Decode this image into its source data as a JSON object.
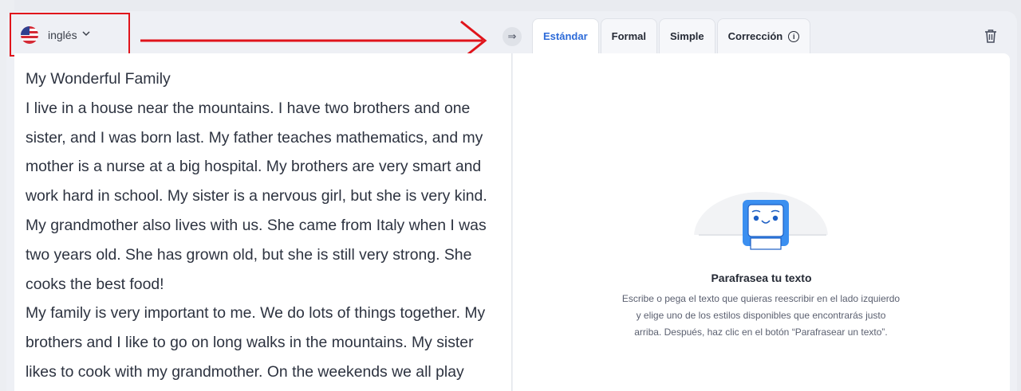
{
  "language": {
    "label": "inglés",
    "flag_icon": "us-flag-icon"
  },
  "swap_icon": "⇒",
  "tabs": [
    {
      "label": "Estándar",
      "active": true
    },
    {
      "label": "Formal",
      "active": false
    },
    {
      "label": "Simple",
      "active": false
    },
    {
      "label": "Corrección",
      "active": false
    }
  ],
  "input_text": "My Wonderful Family\nI live in a house near the mountains. I have two brothers and one\nsister, and I was born last. My father teaches mathematics, and my\nmother is a nurse at a big hospital. My brothers are very smart and\nwork hard in school. My sister is a nervous girl, but she is very kind.\nMy grandmother also lives with us. She came from Italy when I was\ntwo years old. She has grown old, but she is still very strong. She\ncooks the best food!\nMy family is very important to me. We do lots of things together. My\nbrothers and I like to go on long walks in the mountains. My sister\nlikes to cook with my grandmother. On the weekends we all play",
  "empty_state": {
    "title": "Parafrasea tu texto",
    "description": "Escribe o pega el texto que quieras reescribir en el lado izquierdo y elige uno de los estilos disponibles que encontrarás justo arriba. Después, haz clic en el botón “Parafrasear un texto”."
  },
  "colors": {
    "accent": "#2c6ad8",
    "highlight": "#e0141b",
    "mascot": "#3b8ff0"
  }
}
